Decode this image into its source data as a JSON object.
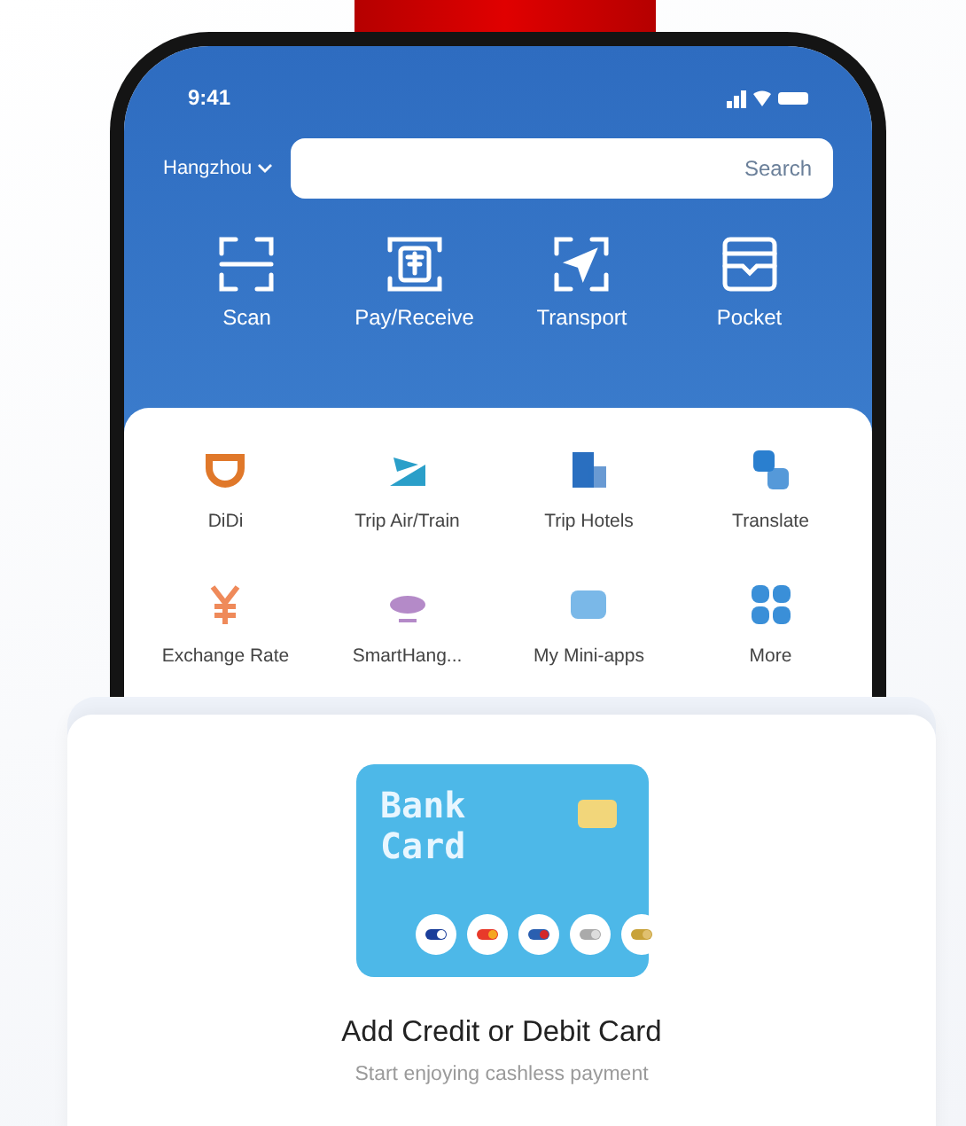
{
  "status_bar": {
    "time": "9:41"
  },
  "header": {
    "location": "Hangzhou",
    "search_button": "Search"
  },
  "quick_actions": [
    {
      "label": "Scan"
    },
    {
      "label": "Pay/Receive"
    },
    {
      "label": "Transport"
    },
    {
      "label": "Pocket"
    }
  ],
  "mini_apps": [
    {
      "label": "DiDi",
      "color": "#e0782a"
    },
    {
      "label": "Trip Air/Train",
      "color": "#2a9fc9"
    },
    {
      "label": "Trip Hotels",
      "color": "#2a6fc0"
    },
    {
      "label": "Translate",
      "color": "#2a7fcf"
    },
    {
      "label": "Exchange Rate",
      "color": "#ef8a5a"
    },
    {
      "label": "SmartHang...",
      "color": "#b48ac8"
    },
    {
      "label": "My Mini-apps",
      "color": "#7ab8e8"
    },
    {
      "label": "More",
      "color": "#3a8fd8"
    }
  ],
  "card_sheet": {
    "card_title": "Bank Card",
    "title": "Add Credit or Debit Card",
    "subtitle": "Start enjoying cashless payment"
  }
}
